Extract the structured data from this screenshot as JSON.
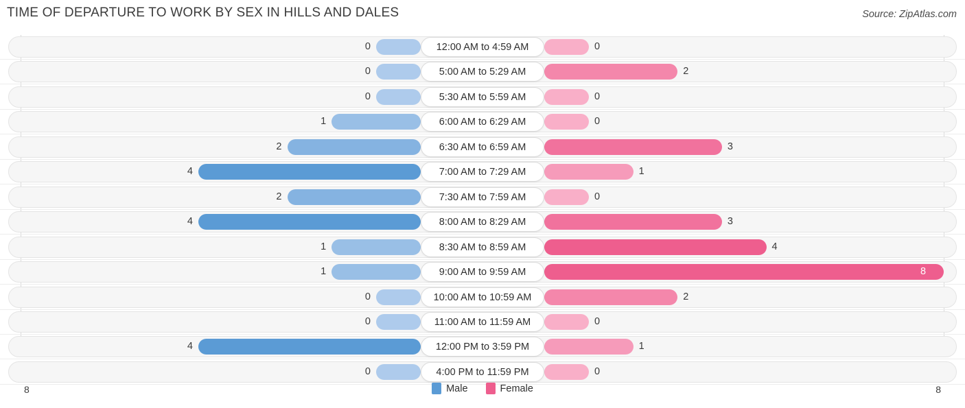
{
  "header": {
    "title": "TIME OF DEPARTURE TO WORK BY SEX IN HILLS AND DALES",
    "source": "Source: ZipAtlas.com"
  },
  "axis": {
    "left_max_label": "8",
    "right_max_label": "8"
  },
  "legend": {
    "items": [
      {
        "label": "Male",
        "color": "#5b9bd5"
      },
      {
        "label": "Female",
        "color": "#ee5e8e"
      }
    ]
  },
  "chart_data": {
    "type": "bar",
    "subtype": "diverging-horizontal-bar",
    "title": "TIME OF DEPARTURE TO WORK BY SEX IN HILLS AND DALES",
    "xlabel": "",
    "ylabel": "",
    "xlim": [
      8,
      8
    ],
    "grid": true,
    "legend_position": "bottom-center",
    "categories": [
      "12:00 AM to 4:59 AM",
      "5:00 AM to 5:29 AM",
      "5:30 AM to 5:59 AM",
      "6:00 AM to 6:29 AM",
      "6:30 AM to 6:59 AM",
      "7:00 AM to 7:29 AM",
      "7:30 AM to 7:59 AM",
      "8:00 AM to 8:29 AM",
      "8:30 AM to 8:59 AM",
      "9:00 AM to 9:59 AM",
      "10:00 AM to 10:59 AM",
      "11:00 AM to 11:59 AM",
      "12:00 PM to 3:59 PM",
      "4:00 PM to 11:59 PM"
    ],
    "series": [
      {
        "name": "Male",
        "color": "#5b9bd5",
        "values": [
          0,
          0,
          0,
          1,
          2,
          4,
          2,
          4,
          1,
          1,
          0,
          0,
          4,
          0
        ],
        "labels": [
          "0",
          "0",
          "0",
          "1",
          "2",
          "4",
          "2",
          "4",
          "1",
          "1",
          "0",
          "0",
          "4",
          "0"
        ]
      },
      {
        "name": "Female",
        "color": "#ee5e8e",
        "values": [
          0,
          2,
          0,
          0,
          3,
          1,
          0,
          3,
          4,
          8,
          2,
          0,
          1,
          0
        ],
        "labels": [
          "0",
          "2",
          "0",
          "0",
          "3",
          "1",
          "0",
          "3",
          "4",
          "8",
          "2",
          "0",
          "1",
          "0"
        ]
      }
    ]
  }
}
